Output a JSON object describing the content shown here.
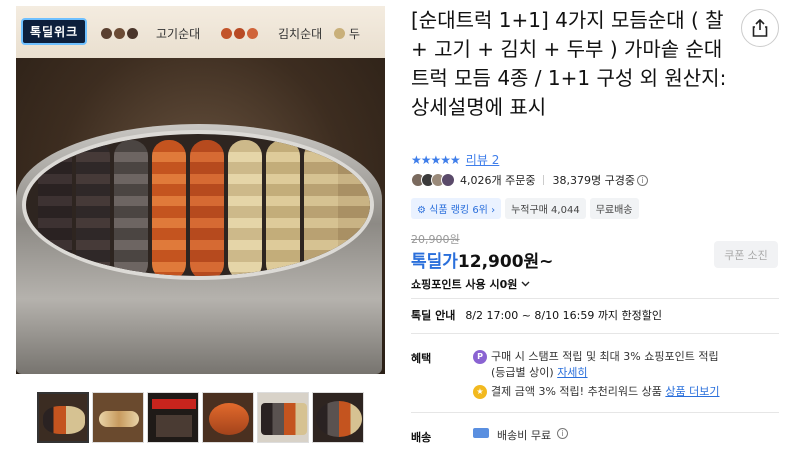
{
  "brand_badge": "톡딜위크",
  "banner": {
    "items": [
      "고기순대",
      "김치순대",
      "두"
    ]
  },
  "product": {
    "title": "[순대트럭 1+1] 4가지 모듬순대 ( 찰 + 고기 + 김치 + 두부 ) 가마솥 순대트럭 모듬 4종 / 1+1 구성 외 원산지: 상세설명에 표시",
    "stars": "★★★★★",
    "review_label": "리뷰 2",
    "orders": "4,026개 주문중",
    "subscribers": "38,379명 구경중",
    "tags": {
      "rank": "식품 랭킹 6위",
      "cumulative": "누적구매 4,044",
      "shipping": "무료배송"
    },
    "original_price": "20,900원",
    "deal_label": "톡딜가",
    "deal_price": "12,900원~",
    "coupon": "쿠폰 소진",
    "shopping_point": "쇼핑포인트 사용 시0원"
  },
  "deal": {
    "label": "톡딜 안내",
    "period": "8/2 17:00 ~ 8/10 16:59 까지 한정할인"
  },
  "benefits": {
    "label": "혜택",
    "line1": "구매 시 스탬프 적립 및 최대 3% 쇼핑포인트 적립",
    "line1_sub": "(등급별 상이)",
    "line1_link": "자세히",
    "line2": "결제 금액 3% 적립! 추천리워드 상품",
    "line2_link": "상품 더보기"
  },
  "shipping": {
    "label": "배송",
    "value": "배송비 무료"
  },
  "colors": {
    "accent_blue": "#2a6fdb",
    "star_blue": "#3f7eea",
    "point_purple": "#8a63d2",
    "reward_yellow": "#f2b91f"
  },
  "icons": [
    "share-icon",
    "info-icon",
    "point-icon",
    "reward-icon",
    "truck-icon",
    "chevron-down-icon"
  ]
}
